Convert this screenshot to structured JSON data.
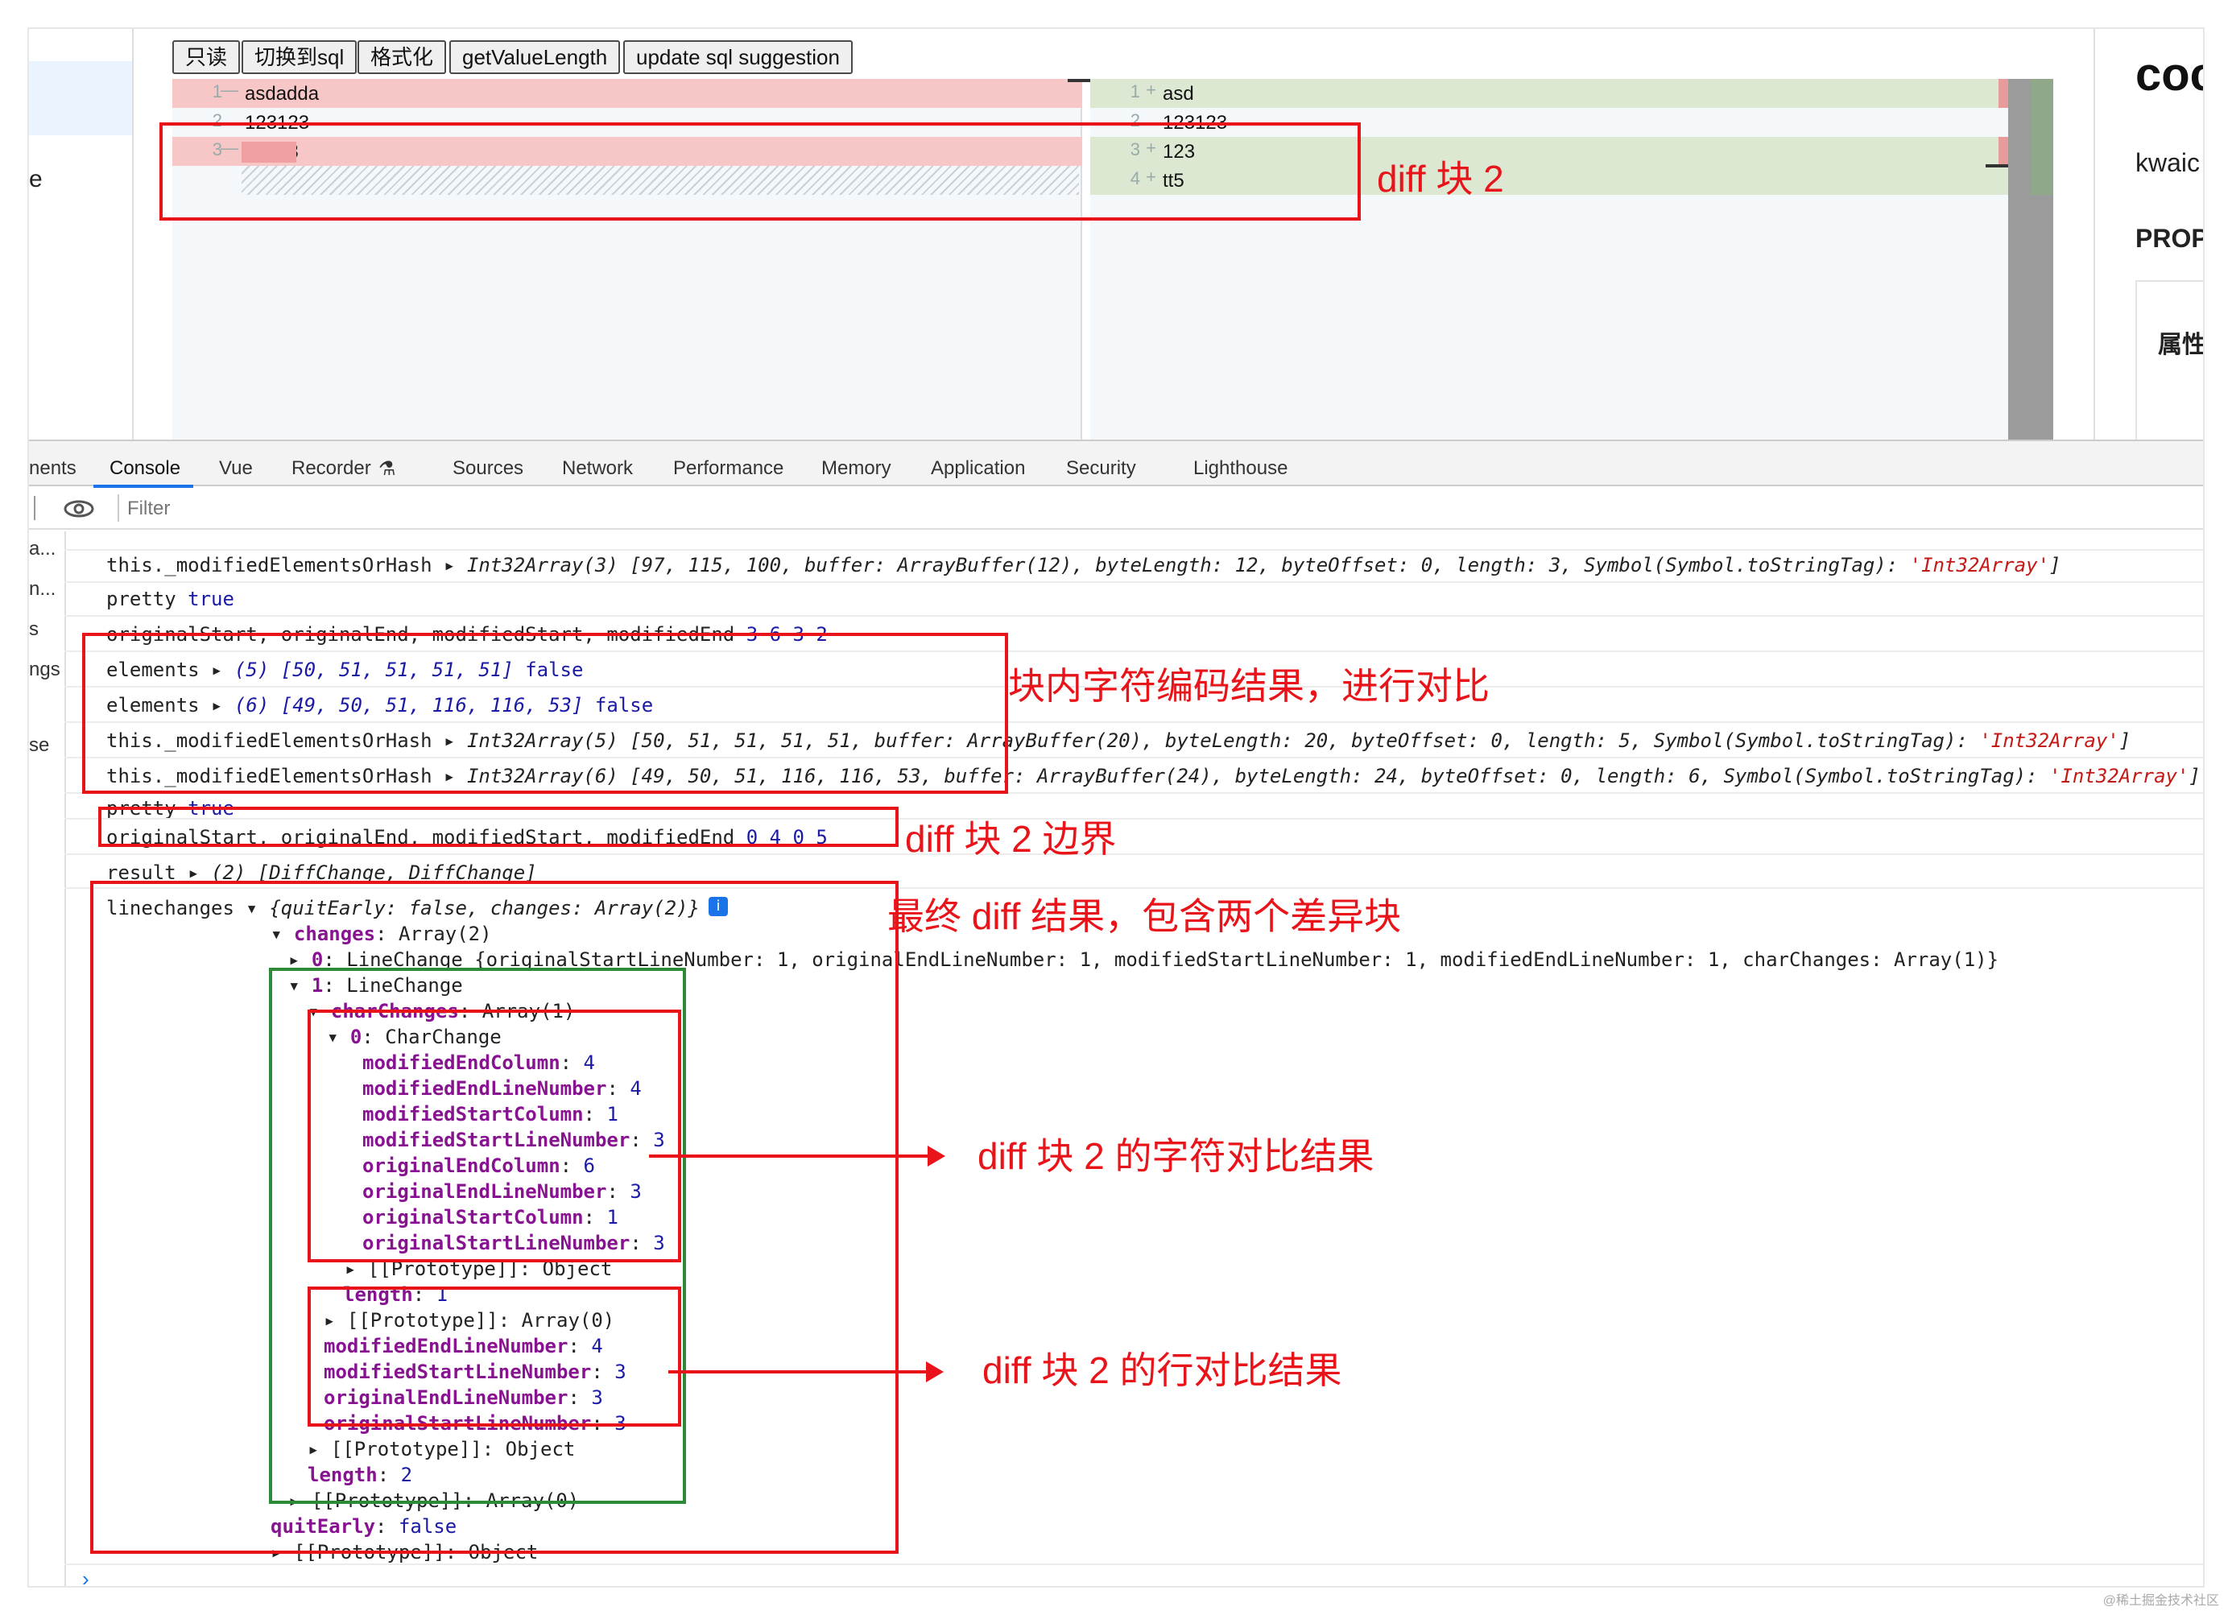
{
  "toolbar": {
    "readonly": "只读",
    "switch_sql": "切换到sql",
    "format": "格式化",
    "get_value_length": "getValueLength",
    "update_sql": "update sql suggestion"
  },
  "left_sidebar": {
    "fragment": "e"
  },
  "editor_left": [
    {
      "num": "1",
      "mark": "—",
      "text": "asdadda"
    },
    {
      "num": "2",
      "mark": "",
      "text": "123123"
    },
    {
      "num": "3",
      "mark": "—",
      "text": "23333"
    }
  ],
  "editor_right": [
    {
      "num": "1",
      "mark": "+",
      "text": "asd"
    },
    {
      "num": "2",
      "mark": "",
      "text": "123123"
    },
    {
      "num": "3",
      "mark": "+",
      "text": "123"
    },
    {
      "num": "4",
      "mark": "+",
      "text": "tt5"
    }
  ],
  "right_panel": {
    "title": "coc",
    "sub": "kwaic",
    "prop": "PROP",
    "attr": "属性"
  },
  "devtools_tabs": [
    "nents",
    "Console",
    "Vue",
    "Recorder",
    "Sources",
    "Network",
    "Performance",
    "Memory",
    "Application",
    "Security",
    "Lighthouse"
  ],
  "filter_placeholder": "Filter",
  "sidebar_fragments": [
    "a...",
    "n...",
    "s",
    "ngs",
    "se"
  ],
  "console": {
    "l1_key": "this._modifiedElementsOrHash",
    "l1_val": "Int32Array(3) [97, 115, 100, buffer: ArrayBuffer(12), byteLength: 12, byteOffset: 0, length: 3, Symbol(Symbol.toStringTag): ",
    "l1_str": "'Int32Array'",
    "l1_end": "]",
    "l2_key": "pretty",
    "l2_val": "true",
    "l3_key": "originalStart, originalEnd, modifiedStart, modifiedEnd",
    "l3_val": "3 6 3 2",
    "l4_key": "elements",
    "l4_val": "(5) [50, 51, 51, 51, 51]",
    "l4_b": "false",
    "l5_key": "elements",
    "l5_val": "(6) [49, 50, 51, 116, 116, 53]",
    "l5_b": "false",
    "l6_key": "this._modifiedElementsOrHash",
    "l6_val": "Int32Array(5) [50, 51, 51, 51, 51, buffer: ArrayBuffer(20), byteLength: 20, byteOffset: 0, length: 5, Symbol(Symbol.toStringTag): ",
    "l6_str": "'Int32Array'",
    "l6_end": "]",
    "l7_key": "this._modifiedElementsOrHash",
    "l7_val": "Int32Array(6) [49, 50, 51, 116, 116, 53, buffer: ArrayBuffer(24), byteLength: 24, byteOffset: 0, length: 6, Symbol(Symbol.toStringTag): ",
    "l7_str": "'Int32Array'",
    "l7_end": "]",
    "l8_key": "pretty",
    "l8_val": "true",
    "l9_key": "originalStart, originalEnd, modifiedStart, modifiedEnd",
    "l9_val": "0 4 0 5",
    "l10_key": "result",
    "l10_val": "(2) [DiffChange, DiffChange]",
    "lc_key": "linechanges",
    "lc_val": "{quitEarly: false, changes: Array(2)}",
    "tree": {
      "changes_k": "changes",
      "changes_v": "Array(2)",
      "c0_k": "0",
      "c0_v": "LineChange {originalStartLineNumber: 1, originalEndLineNumber: 1, modifiedStartLineNumber: 1, modifiedEndLineNumber: 1, charChanges: Array(1)}",
      "c1_k": "1",
      "c1_v": "LineChange",
      "cc_k": "charChanges",
      "cc_v": "Array(1)",
      "cc0_k": "0",
      "cc0_v": "CharChange",
      "p1_k": "modifiedEndColumn",
      "p1_v": "4",
      "p2_k": "modifiedEndLineNumber",
      "p2_v": "4",
      "p3_k": "modifiedStartColumn",
      "p3_v": "1",
      "p4_k": "modifiedStartLineNumber",
      "p4_v": "3",
      "p5_k": "originalEndColumn",
      "p5_v": "6",
      "p6_k": "originalEndLineNumber",
      "p6_v": "3",
      "p7_k": "originalStartColumn",
      "p7_v": "1",
      "p8_k": "originalStartLineNumber",
      "p8_v": "3",
      "proto_obj": "[[Prototype]]: Object",
      "len1_k": "length",
      "len1_v": "1",
      "proto_arr": "[[Prototype]]: Array(0)",
      "q1_k": "modifiedEndLineNumber",
      "q1_v": "4",
      "q2_k": "modifiedStartLineNumber",
      "q2_v": "3",
      "q3_k": "originalEndLineNumber",
      "q3_v": "3",
      "q4_k": "originalStartLineNumber",
      "q4_v": "3",
      "len2_k": "length",
      "len2_v": "2",
      "quit_k": "quitEarly",
      "quit_v": "false"
    }
  },
  "annotations": {
    "a1": "diff 块 2",
    "a2": "块内字符编码结果，进行对比",
    "a3": "diff 块 2 边界",
    "a4": "最终 diff 结果，包含两个差异块",
    "a5": "diff 块 2 的字符对比结果",
    "a6": "diff 块 2 的行对比结果"
  },
  "watermark": "@稀土掘金技术社区",
  "colors": {
    "annotation_red": "#e8141a",
    "annotation_green": "#2d8a37",
    "removed_bg": "#f7c7c7",
    "added_bg": "#dde8d3"
  }
}
